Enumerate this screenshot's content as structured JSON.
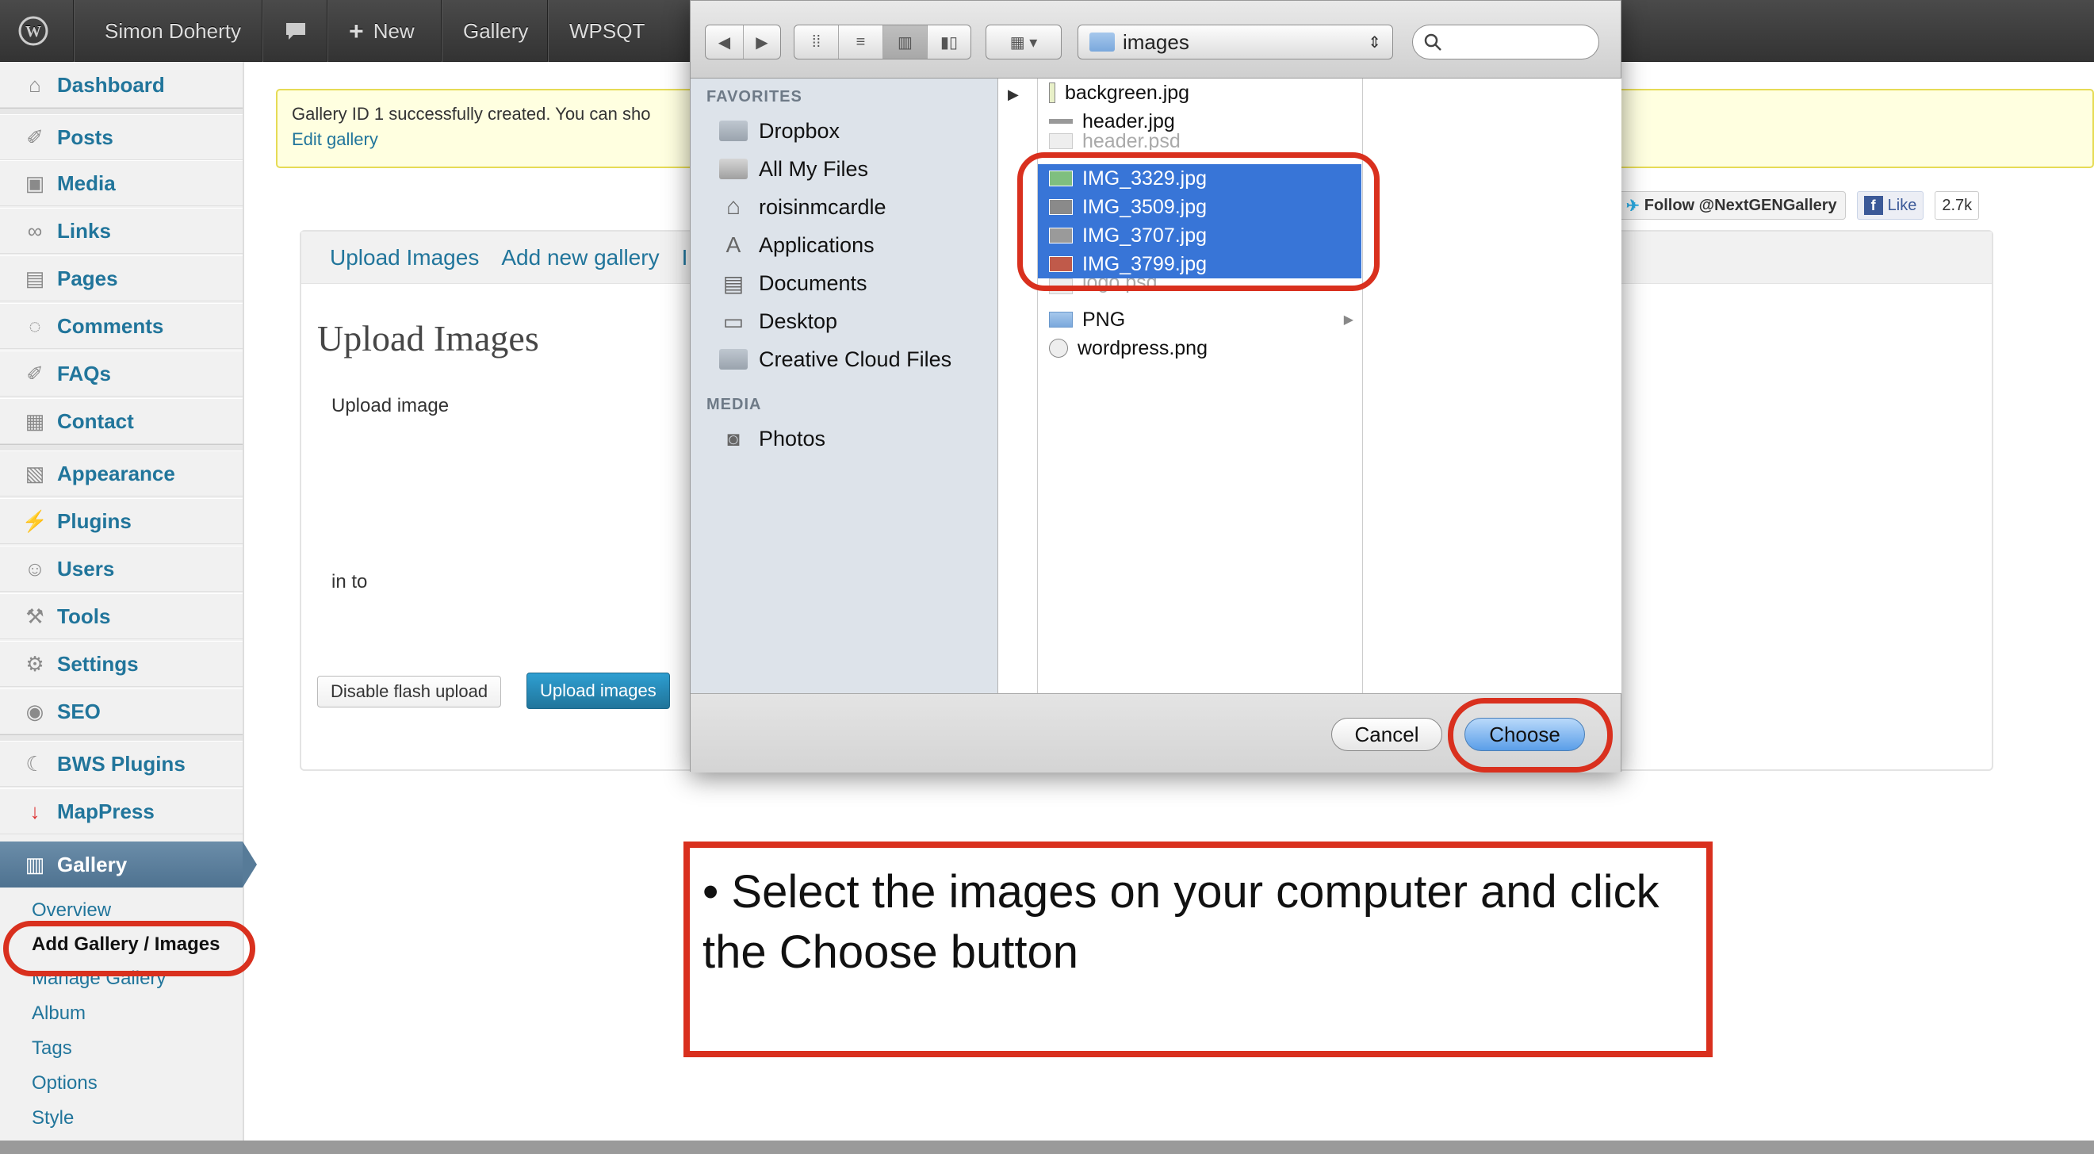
{
  "adminbar": {
    "user": "Simon Doherty",
    "new_label": "New",
    "gallery_label": "Gallery",
    "wpsqt_label": "WPSQT"
  },
  "sidebar": {
    "items": [
      {
        "label": "Dashboard",
        "icon": "home-icon"
      },
      {
        "label": "Posts",
        "icon": "pin-icon"
      },
      {
        "label": "Media",
        "icon": "media-icon"
      },
      {
        "label": "Links",
        "icon": "link-icon"
      },
      {
        "label": "Pages",
        "icon": "page-icon"
      },
      {
        "label": "Comments",
        "icon": "comment-icon"
      },
      {
        "label": "FAQs",
        "icon": "pin-icon"
      },
      {
        "label": "Contact",
        "icon": "contact-icon"
      },
      {
        "label": "Appearance",
        "icon": "appearance-icon"
      },
      {
        "label": "Plugins",
        "icon": "plugin-icon"
      },
      {
        "label": "Users",
        "icon": "users-icon"
      },
      {
        "label": "Tools",
        "icon": "tools-icon"
      },
      {
        "label": "Settings",
        "icon": "settings-icon"
      },
      {
        "label": "SEO",
        "icon": "seo-icon"
      },
      {
        "label": "BWS Plugins",
        "icon": "bws-icon"
      },
      {
        "label": "MapPress",
        "icon": "map-pin-icon"
      },
      {
        "label": "Gallery",
        "icon": "gallery-icon"
      }
    ],
    "gallery_submenu": [
      "Overview",
      "Add Gallery / Images",
      "Manage Gallery",
      "Album",
      "Tags",
      "Options",
      "Style"
    ]
  },
  "notice": {
    "line1": "Gallery ID 1 successfully created. You can sho",
    "edit_link": "Edit gallery"
  },
  "social": {
    "follow": "Follow @NextGENGallery",
    "like": "Like",
    "count": "2.7k"
  },
  "panel": {
    "tabs": [
      "Upload Images",
      "Add new gallery",
      "I"
    ],
    "title": "Upload Images",
    "upload_image_label": "Upload image",
    "in_to_label": "in to",
    "disable_flash_btn": "Disable flash upload",
    "upload_images_btn": "Upload images"
  },
  "dialog": {
    "path": "images",
    "sidebar": {
      "favorites_header": "FAVORITES",
      "favorites": [
        "Dropbox",
        "All My Files",
        "roisinmcardle",
        "Applications",
        "Documents",
        "Desktop",
        "Creative Cloud Files"
      ],
      "media_header": "MEDIA",
      "media": [
        "Photos"
      ]
    },
    "files": [
      {
        "name": "backgreen.jpg",
        "state": "normal"
      },
      {
        "name": "header.jpg",
        "state": "normal"
      },
      {
        "name": "header.psd",
        "state": "dim"
      },
      {
        "name": "IMG_3329.jpg",
        "state": "selected"
      },
      {
        "name": "IMG_3509.jpg",
        "state": "selected"
      },
      {
        "name": "IMG_3707.jpg",
        "state": "selected"
      },
      {
        "name": "IMG_3799.jpg",
        "state": "selected"
      },
      {
        "name": "logo.psd",
        "state": "dim"
      },
      {
        "name": "PNG",
        "state": "folder"
      },
      {
        "name": "wordpress.png",
        "state": "normal"
      }
    ],
    "cancel_label": "Cancel",
    "choose_label": "Choose"
  },
  "callout": {
    "text": "• Select the images on your computer and click the Choose button"
  },
  "colors": {
    "annotation_red": "#d9301e",
    "selection_blue": "#3875d7",
    "wp_link": "#21759b"
  }
}
